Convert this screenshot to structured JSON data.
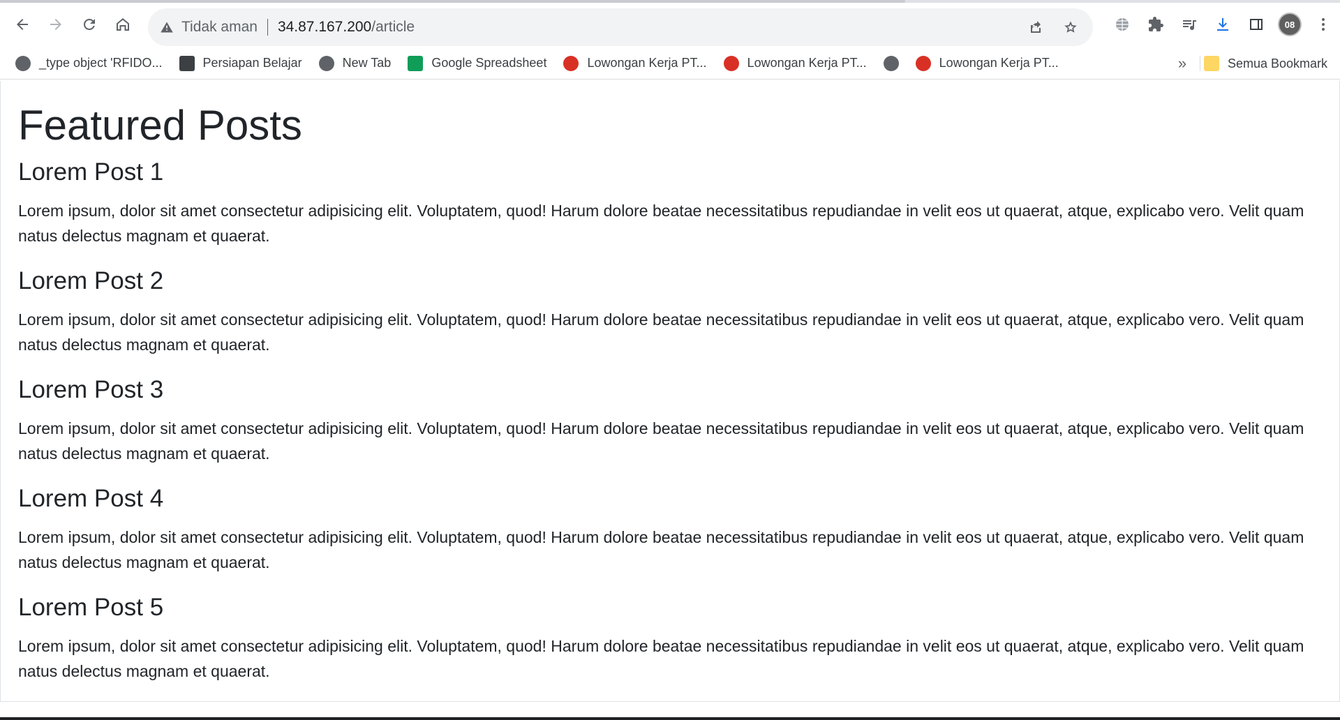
{
  "browser": {
    "security_label": "Tidak aman",
    "url_host": "34.87.167.200",
    "url_path": "/article",
    "avatar_text": "08"
  },
  "bookmarks": {
    "items": [
      {
        "label": "_type object 'RFIDO...",
        "icon": "globe-icon"
      },
      {
        "label": "Persiapan Belajar",
        "icon": "udemy-icon"
      },
      {
        "label": "New Tab",
        "icon": "globe-icon"
      },
      {
        "label": "Google Spreadsheet",
        "icon": "google-sheets-icon"
      },
      {
        "label": "Lowongan Kerja PT...",
        "icon": "jobs-icon"
      },
      {
        "label": "Lowongan Kerja PT...",
        "icon": "jobs-icon"
      },
      {
        "label": "",
        "icon": "globe-icon"
      },
      {
        "label": "Lowongan Kerja PT...",
        "icon": "jobs-icon"
      }
    ],
    "overflow_label": "»",
    "all_bookmarks_label": "Semua Bookmark"
  },
  "page": {
    "title": "Featured Posts",
    "posts": [
      {
        "title": "Lorem Post 1",
        "body": "Lorem ipsum, dolor sit amet consectetur adipisicing elit. Voluptatem, quod! Harum dolore beatae necessitatibus repudiandae in velit eos ut quaerat, atque, explicabo vero. Velit quam natus delectus magnam et quaerat."
      },
      {
        "title": "Lorem Post 2",
        "body": "Lorem ipsum, dolor sit amet consectetur adipisicing elit. Voluptatem, quod! Harum dolore beatae necessitatibus repudiandae in velit eos ut quaerat, atque, explicabo vero. Velit quam natus delectus magnam et quaerat."
      },
      {
        "title": "Lorem Post 3",
        "body": "Lorem ipsum, dolor sit amet consectetur adipisicing elit. Voluptatem, quod! Harum dolore beatae necessitatibus repudiandae in velit eos ut quaerat, atque, explicabo vero. Velit quam natus delectus magnam et quaerat."
      },
      {
        "title": "Lorem Post 4",
        "body": "Lorem ipsum, dolor sit amet consectetur adipisicing elit. Voluptatem, quod! Harum dolore beatae necessitatibus repudiandae in velit eos ut quaerat, atque, explicabo vero. Velit quam natus delectus magnam et quaerat."
      },
      {
        "title": "Lorem Post 5",
        "body": "Lorem ipsum, dolor sit amet consectetur adipisicing elit. Voluptatem, quod! Harum dolore beatae necessitatibus repudiandae in velit eos ut quaerat, atque, explicabo vero. Velit quam natus delectus magnam et quaerat."
      }
    ]
  },
  "colors": {
    "download_accent": "#1a73e8",
    "text_primary": "#212529"
  }
}
